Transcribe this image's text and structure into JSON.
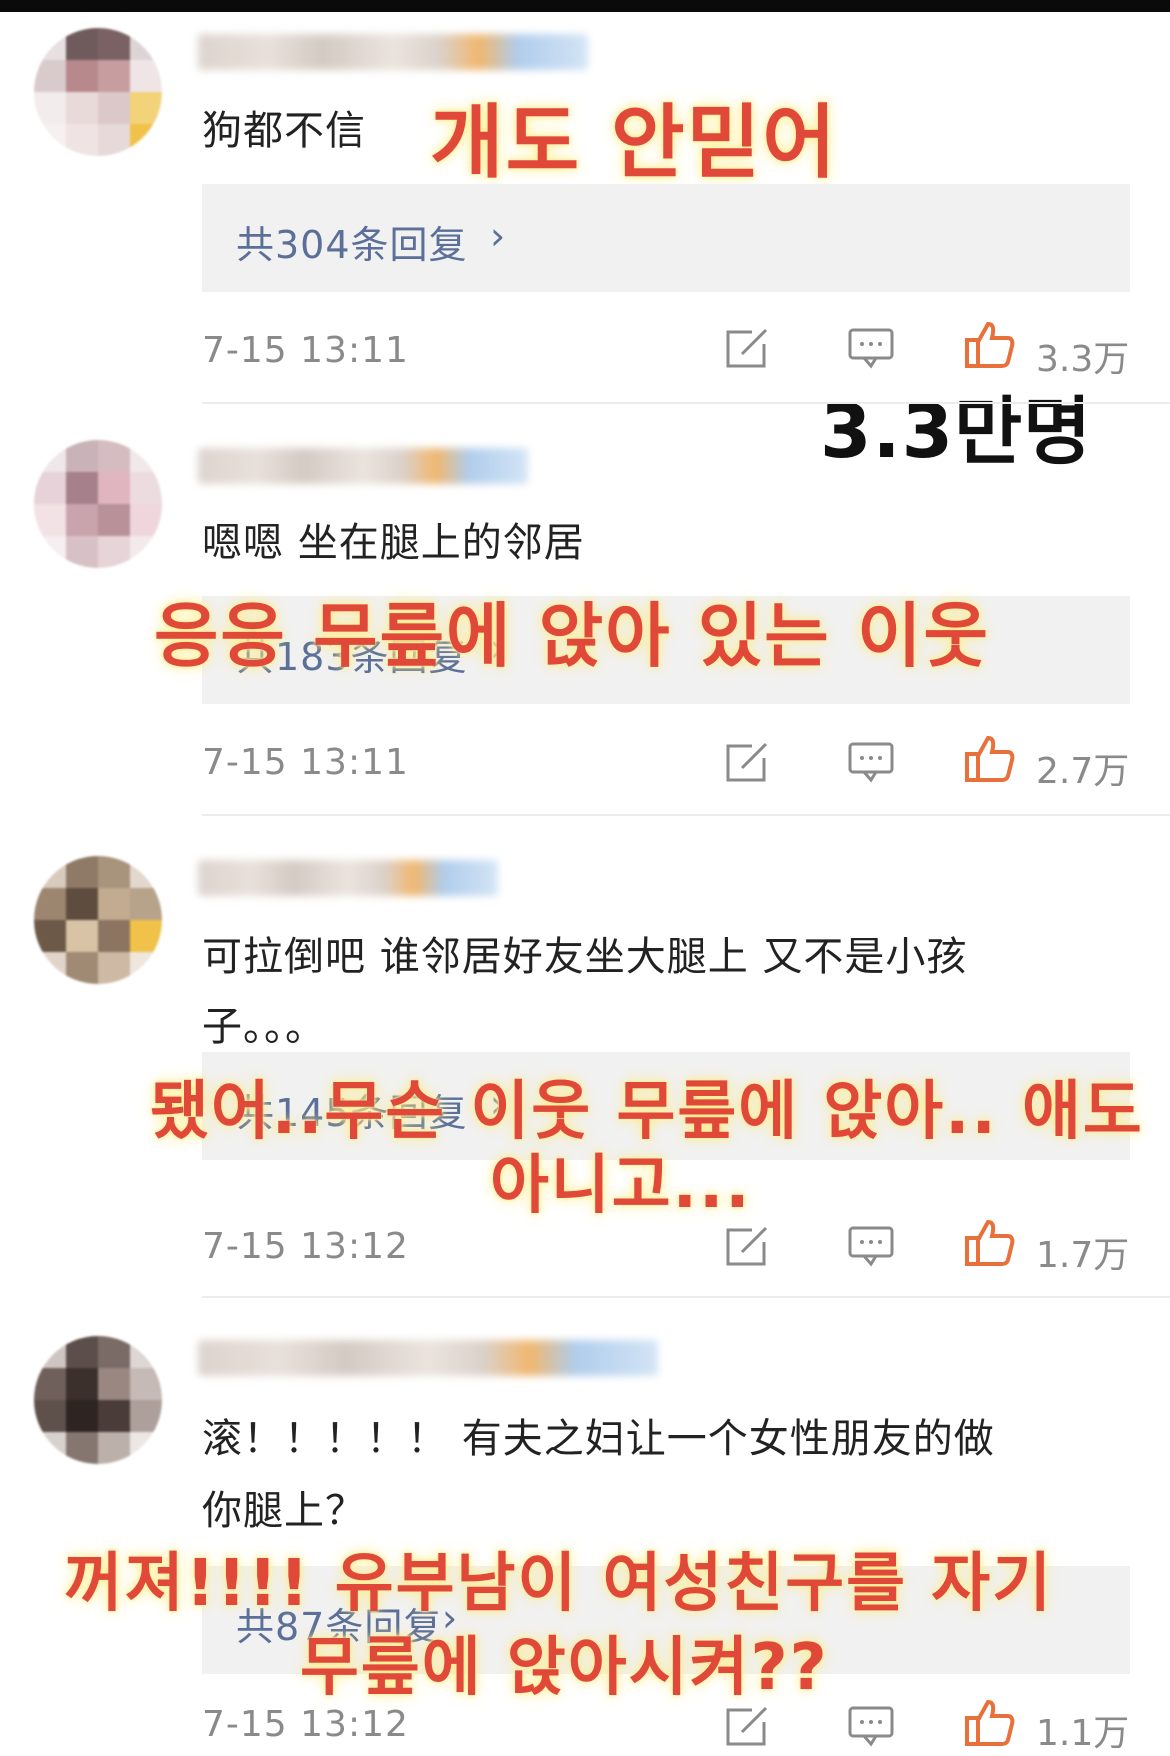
{
  "comments": [
    {
      "text": "狗都不信",
      "text_line2": "",
      "translation": "개도 안믿어",
      "translation_line2": "",
      "reply_label": "共304条回复",
      "time": "7-15 13:11",
      "likes": "3.3万"
    },
    {
      "text": "嗯嗯 坐在腿上的邻居",
      "text_line2": "",
      "translation": "응응 무릎에 앉아 있는 이웃",
      "translation_line2": "",
      "reply_label": "共183条回复",
      "time": "7-15 13:11",
      "likes": "2.7万"
    },
    {
      "text": "可拉倒吧 谁邻居好友坐大腿上 又不是小孩",
      "text_line2": "子。。。",
      "translation": "됐어..무슨 이웃 무릎에 앉아.. 애도",
      "translation_line2": "아니고...",
      "reply_label": "共145条回复",
      "time": "7-15 13:12",
      "likes": "1.7万"
    },
    {
      "text": "滚！！！！！ 有夫之妇让一个女性朋友的做",
      "text_line2": "你腿上？",
      "translation": "꺼져!!!! 유부남이 여성친구를  자기",
      "translation_line2": "무릎에 앉아시켜??",
      "reply_label": "共87条回复",
      "time": "7-15 13:12",
      "likes": "1.1万"
    }
  ],
  "like_note": "3.3만명",
  "icons": {
    "edit": "edit-icon",
    "comment": "comment-icon",
    "like": "like-thumb-icon",
    "chevron": "chevron-right-icon"
  },
  "colors": {
    "overlay_text": "#e0483a",
    "reply_link": "#5b6f98",
    "meta": "#8a8a8a",
    "like_icon": "#e8703a"
  },
  "reply_chevron": "›"
}
